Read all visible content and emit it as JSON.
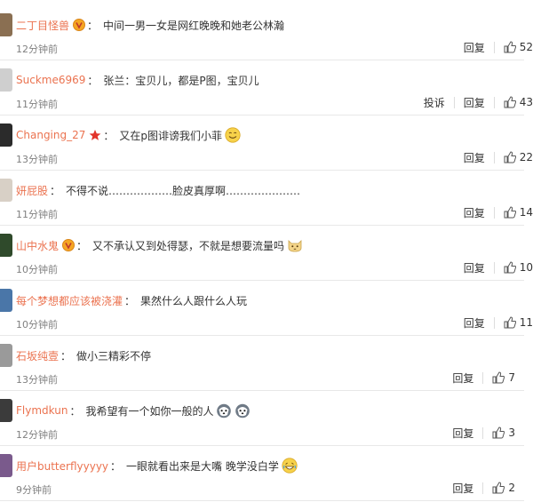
{
  "actions": {
    "reply": "回复",
    "report": "投诉"
  },
  "comments": [
    {
      "username": "二丁目怪兽",
      "text": "中间一男一女是网红晚晚和她老公林瀚",
      "time": "12分钟前",
      "likes": "52",
      "badge": "v-gold",
      "avatar_color": "#8a6f52"
    },
    {
      "username": "Suckme6969",
      "text": "张兰：宝贝儿，都是P图，宝贝儿",
      "time": "11分钟前",
      "likes": "43",
      "avatar_color": "#cfcfcf"
    },
    {
      "username": "Changing_27",
      "text": "又在p图诽谤我们小菲",
      "time": "13分钟前",
      "likes": "22",
      "badge": "star",
      "emoji": "smile",
      "avatar_color": "#2b2b2b"
    },
    {
      "username": "妍屁股",
      "text": "不得不说………………脸皮真厚啊…………………",
      "time": "11分钟前",
      "likes": "14",
      "avatar_color": "#d8d0c6"
    },
    {
      "username": "山中水鬼",
      "text": "又不承认又到处得瑟，不就是想要流量吗",
      "time": "10分钟前",
      "likes": "10",
      "badge": "v-gold",
      "emoji": "cat",
      "avatar_color": "#2f4a2b"
    },
    {
      "username": "每个梦想都应该被浇灌",
      "text": "果然什么人跟什么人玩",
      "time": "10分钟前",
      "likes": "11",
      "avatar_color": "#4a76a8"
    },
    {
      "username": "石坂纯壹",
      "text": "做小三精彩不停",
      "time": "13分钟前",
      "likes": "7",
      "avatar_color": "#9a9a9a"
    },
    {
      "username": "Flymdkun",
      "text": "我希望有一个如你一般的人",
      "time": "12分钟前",
      "likes": "3",
      "emoji": "husky2",
      "avatar_color": "#3b3b3b"
    },
    {
      "username": "用户butterflyyyyy",
      "text": "一眼就看出来是大嘴 晚学没白学",
      "time": "9分钟前",
      "likes": "2",
      "emoji": "laugh",
      "avatar_color": "#7a5a8c"
    }
  ]
}
